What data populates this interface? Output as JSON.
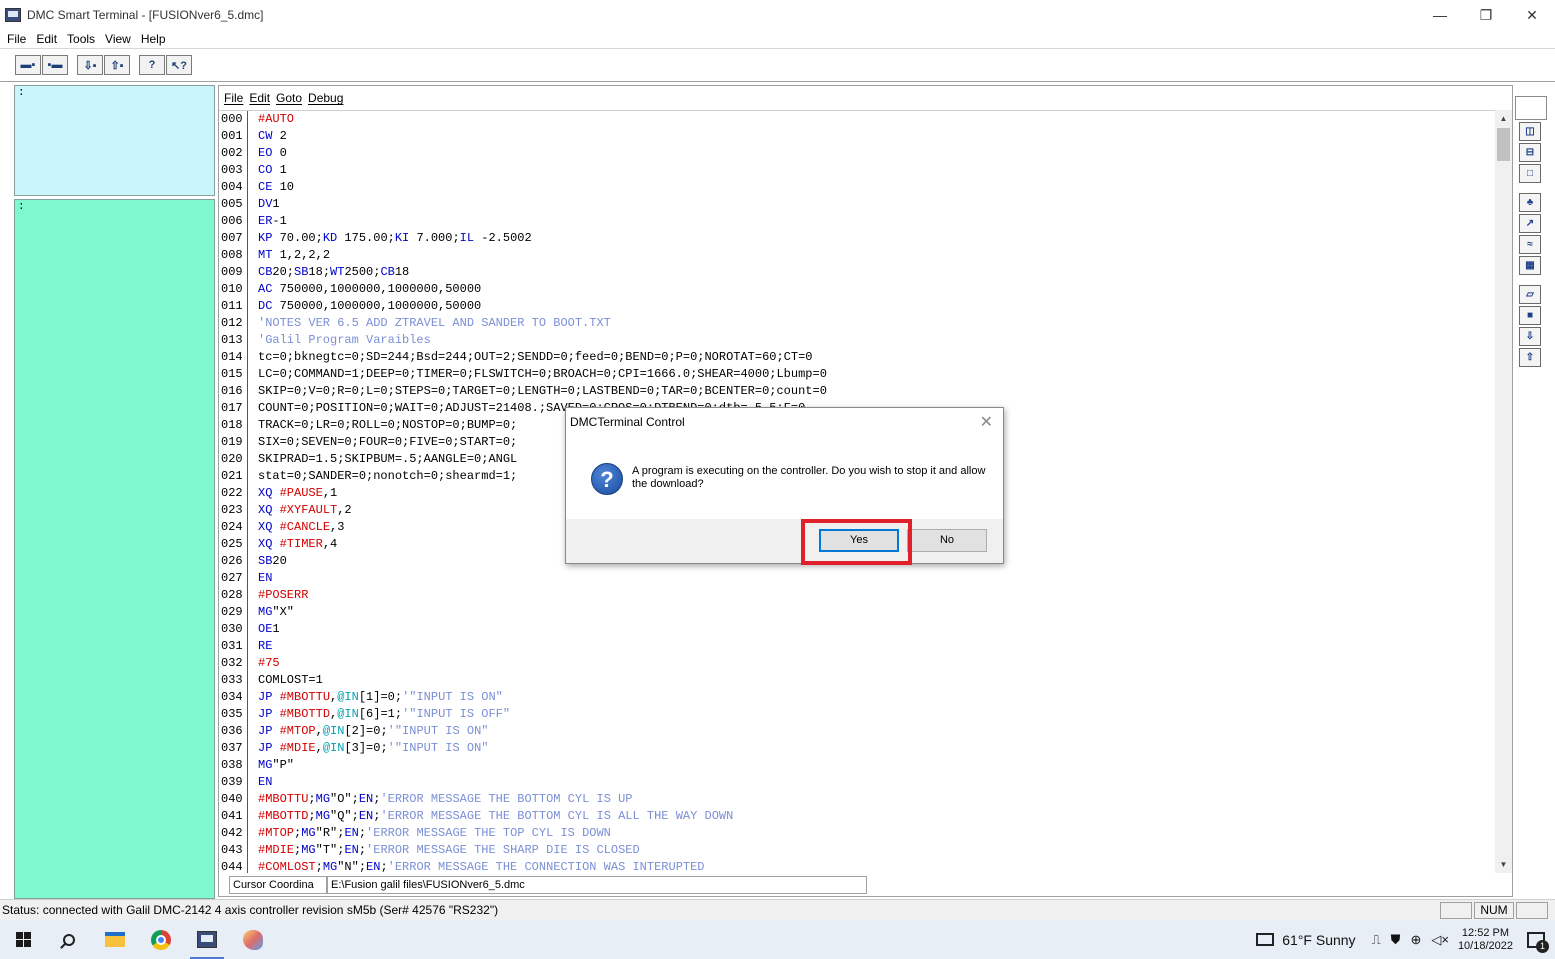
{
  "window": {
    "title": "DMC Smart Terminal - [FUSIONver6_5.dmc]",
    "minimize": "—",
    "maximize": "❐",
    "close": "✕"
  },
  "menubar": [
    "File",
    "Edit",
    "Tools",
    "View",
    "Help"
  ],
  "left_panes": {
    "top_prompt": ":",
    "bottom_prompt": ":"
  },
  "editor": {
    "menu": [
      "File",
      "Edit",
      "Goto",
      "Debug"
    ],
    "lines": [
      {
        "n": "000",
        "parts": [
          [
            "#AUTO",
            "red"
          ]
        ]
      },
      {
        "n": "001",
        "parts": [
          [
            "CW",
            "blue"
          ],
          [
            " 2",
            ""
          ]
        ]
      },
      {
        "n": "002",
        "parts": [
          [
            "EO",
            "blue"
          ],
          [
            " 0",
            ""
          ]
        ]
      },
      {
        "n": "003",
        "parts": [
          [
            "CO",
            "blue"
          ],
          [
            " 1",
            ""
          ]
        ]
      },
      {
        "n": "004",
        "parts": [
          [
            "CE",
            "blue"
          ],
          [
            " 10",
            ""
          ]
        ]
      },
      {
        "n": "005",
        "parts": [
          [
            "DV",
            "blue"
          ],
          [
            "1",
            ""
          ]
        ]
      },
      {
        "n": "006",
        "parts": [
          [
            "ER",
            "blue"
          ],
          [
            "-1",
            ""
          ]
        ]
      },
      {
        "n": "007",
        "parts": [
          [
            "KP",
            "blue"
          ],
          [
            " 70.00;",
            ""
          ],
          [
            "KD",
            "blue"
          ],
          [
            " 175.00;",
            ""
          ],
          [
            "KI",
            "blue"
          ],
          [
            " 7.000;",
            ""
          ],
          [
            "IL",
            "blue"
          ],
          [
            " -2.5002",
            ""
          ]
        ]
      },
      {
        "n": "008",
        "parts": [
          [
            "MT",
            "blue"
          ],
          [
            " 1,2,2,2",
            ""
          ]
        ]
      },
      {
        "n": "009",
        "parts": [
          [
            "CB",
            "blue"
          ],
          [
            "20;",
            ""
          ],
          [
            "SB",
            "blue"
          ],
          [
            "18;",
            ""
          ],
          [
            "WT",
            "blue"
          ],
          [
            "2500;",
            ""
          ],
          [
            "CB",
            "blue"
          ],
          [
            "18",
            ""
          ]
        ]
      },
      {
        "n": "010",
        "parts": [
          [
            "AC",
            "blue"
          ],
          [
            " 750000,1000000,1000000,50000",
            ""
          ]
        ]
      },
      {
        "n": "011",
        "parts": [
          [
            "DC",
            "blue"
          ],
          [
            " 750000,1000000,1000000,50000",
            ""
          ]
        ]
      },
      {
        "n": "012",
        "parts": [
          [
            "'NOTES VER 6.5 ADD ZTRAVEL AND SANDER TO BOOT.TXT",
            "cmt"
          ]
        ]
      },
      {
        "n": "013",
        "parts": [
          [
            "'Galil Program Varaibles",
            "cmt"
          ]
        ]
      },
      {
        "n": "014",
        "parts": [
          [
            "tc=0;bknegtc=0;SD=244;Bsd=244;OUT=2;SENDD=0;feed=0;BEND=0;P=0;NOROTAT=60;CT=0",
            ""
          ]
        ]
      },
      {
        "n": "015",
        "parts": [
          [
            "LC=0;COMMAND=1;DEEP=0;TIMER=0;FLSWITCH=0;BROACH=0;CPI=1666.0;SHEAR=4000;Lbump=0",
            ""
          ]
        ]
      },
      {
        "n": "016",
        "parts": [
          [
            "SKIP=0;V=0;R=0;L=0;STEPS=0;TARGET=0;LENGTH=0;LASTBEND=0;TAR=0;BCENTER=0;count=0",
            ""
          ]
        ]
      },
      {
        "n": "017",
        "parts": [
          [
            "COUNT=0;POSITION=0;WAIT=0;ADJUST=21408.;SAVED=0;CPOS=0;DTBEND=0;dtb=-5.5;F=0",
            ""
          ]
        ]
      },
      {
        "n": "018",
        "parts": [
          [
            "TRACK=0;LR=0;ROLL=0;NOSTOP=0;BUMP=0;",
            ""
          ]
        ]
      },
      {
        "n": "019",
        "parts": [
          [
            "SIX=0;SEVEN=0;FOUR=0;FIVE=0;START=0;",
            ""
          ]
        ]
      },
      {
        "n": "020",
        "parts": [
          [
            "SKIPRAD=1.5;SKIPBUM=.5;AANGLE=0;ANGL",
            ""
          ]
        ]
      },
      {
        "n": "021",
        "parts": [
          [
            "stat=0;SANDER=0;nonotch=0;shearmd=1;",
            ""
          ]
        ]
      },
      {
        "n": "022",
        "parts": [
          [
            "XQ",
            "blue"
          ],
          [
            " ",
            ""
          ],
          [
            "#PAUSE",
            "red"
          ],
          [
            ",1",
            ""
          ]
        ]
      },
      {
        "n": "023",
        "parts": [
          [
            "XQ",
            "blue"
          ],
          [
            " ",
            ""
          ],
          [
            "#XYFAULT",
            "red"
          ],
          [
            ",2",
            ""
          ]
        ]
      },
      {
        "n": "024",
        "parts": [
          [
            "XQ",
            "blue"
          ],
          [
            " ",
            ""
          ],
          [
            "#CANCLE",
            "red"
          ],
          [
            ",3",
            ""
          ]
        ]
      },
      {
        "n": "025",
        "parts": [
          [
            "XQ",
            "blue"
          ],
          [
            " ",
            ""
          ],
          [
            "#TIMER",
            "red"
          ],
          [
            ",4",
            ""
          ]
        ]
      },
      {
        "n": "026",
        "parts": [
          [
            "SB",
            "blue"
          ],
          [
            "20",
            ""
          ]
        ]
      },
      {
        "n": "027",
        "parts": [
          [
            "EN",
            "blue"
          ]
        ]
      },
      {
        "n": "028",
        "parts": [
          [
            "#POSERR",
            "red"
          ]
        ]
      },
      {
        "n": "029",
        "parts": [
          [
            "MG",
            "blue"
          ],
          [
            "\"X\"",
            ""
          ]
        ]
      },
      {
        "n": "030",
        "parts": [
          [
            "OE",
            "blue"
          ],
          [
            "1",
            ""
          ]
        ]
      },
      {
        "n": "031",
        "parts": [
          [
            "RE",
            "blue"
          ]
        ]
      },
      {
        "n": "032",
        "parts": [
          [
            "#75",
            "red"
          ]
        ]
      },
      {
        "n": "033",
        "parts": [
          [
            "COMLOST=1",
            ""
          ]
        ]
      },
      {
        "n": "034",
        "parts": [
          [
            "JP",
            "blue"
          ],
          [
            " ",
            ""
          ],
          [
            "#MBOTTU",
            "red"
          ],
          [
            ",",
            ""
          ],
          [
            "@IN",
            "cyan"
          ],
          [
            "[1]=0;",
            ""
          ],
          [
            "'\"INPUT IS ON\"",
            "cmt"
          ]
        ]
      },
      {
        "n": "035",
        "parts": [
          [
            "JP",
            "blue"
          ],
          [
            " ",
            ""
          ],
          [
            "#MBOTTD",
            "red"
          ],
          [
            ",",
            ""
          ],
          [
            "@IN",
            "cyan"
          ],
          [
            "[6]=1;",
            ""
          ],
          [
            "'\"INPUT IS OFF\"",
            "cmt"
          ]
        ]
      },
      {
        "n": "036",
        "parts": [
          [
            "JP",
            "blue"
          ],
          [
            " ",
            ""
          ],
          [
            "#MTOP",
            "red"
          ],
          [
            ",",
            ""
          ],
          [
            "@IN",
            "cyan"
          ],
          [
            "[2]=0;",
            ""
          ],
          [
            "'\"INPUT IS ON\"",
            "cmt"
          ]
        ]
      },
      {
        "n": "037",
        "parts": [
          [
            "JP",
            "blue"
          ],
          [
            " ",
            ""
          ],
          [
            "#MDIE",
            "red"
          ],
          [
            ",",
            ""
          ],
          [
            "@IN",
            "cyan"
          ],
          [
            "[3]=0;",
            ""
          ],
          [
            "'\"INPUT IS ON\"",
            "cmt"
          ]
        ]
      },
      {
        "n": "038",
        "parts": [
          [
            "MG",
            "blue"
          ],
          [
            "\"P\"",
            ""
          ]
        ]
      },
      {
        "n": "039",
        "parts": [
          [
            "EN",
            "blue"
          ]
        ]
      },
      {
        "n": "040",
        "parts": [
          [
            "#MBOTTU",
            "red"
          ],
          [
            ";",
            ""
          ],
          [
            "MG",
            "blue"
          ],
          [
            "\"O\";",
            ""
          ],
          [
            "EN",
            "blue"
          ],
          [
            ";",
            ""
          ],
          [
            "'ERROR MESSAGE THE BOTTOM CYL IS UP",
            "cmt"
          ]
        ]
      },
      {
        "n": "041",
        "parts": [
          [
            "#MBOTTD",
            "red"
          ],
          [
            ";",
            ""
          ],
          [
            "MG",
            "blue"
          ],
          [
            "\"Q\";",
            ""
          ],
          [
            "EN",
            "blue"
          ],
          [
            ";",
            ""
          ],
          [
            "'ERROR MESSAGE THE BOTTOM CYL IS ALL THE WAY DOWN",
            "cmt"
          ]
        ]
      },
      {
        "n": "042",
        "parts": [
          [
            "#MTOP",
            "red"
          ],
          [
            ";",
            ""
          ],
          [
            "MG",
            "blue"
          ],
          [
            "\"R\";",
            ""
          ],
          [
            "EN",
            "blue"
          ],
          [
            ";",
            ""
          ],
          [
            "'ERROR MESSAGE THE TOP CYL IS DOWN",
            "cmt"
          ]
        ]
      },
      {
        "n": "043",
        "parts": [
          [
            "#MDIE",
            "red"
          ],
          [
            ";",
            ""
          ],
          [
            "MG",
            "blue"
          ],
          [
            "\"T\";",
            ""
          ],
          [
            "EN",
            "blue"
          ],
          [
            ";",
            ""
          ],
          [
            "'ERROR MESSAGE THE SHARP DIE IS CLOSED",
            "cmt"
          ]
        ]
      },
      {
        "n": "044",
        "parts": [
          [
            "#COMLOST",
            "red"
          ],
          [
            ";",
            ""
          ],
          [
            "MG",
            "blue"
          ],
          [
            "\"N\";",
            ""
          ],
          [
            "EN",
            "blue"
          ],
          [
            ";",
            ""
          ],
          [
            "'ERROR MESSAGE THE CONNECTION WAS INTERUPTED",
            "cmt"
          ]
        ]
      }
    ],
    "status_cursor": "Cursor Coordina",
    "status_file": "E:\\Fusion galil files\\FUSIONver6_5.dmc"
  },
  "dialog": {
    "title": "DMCTerminal Control",
    "message": "A program is executing on the controller. Do you wish to stop it and allow the download?",
    "yes_label": "Yes",
    "no_label": "No",
    "close": "✕"
  },
  "statusbar": {
    "text": "Status: connected with Galil DMC-2142 4 axis controller revision sM5b (Ser# 42576 \"RS232\")",
    "num": "NUM"
  },
  "taskbar": {
    "weather": "61°F  Sunny",
    "time": "12:52 PM",
    "date": "10/18/2022",
    "notifications": "1"
  },
  "colors": {
    "pane_top": "#c8f6fb",
    "pane_bottom": "#7ff7cf",
    "keyword": "#0000c8",
    "label": "#d40000",
    "comment": "#7b8fd6",
    "highlight": "#e0202a"
  }
}
